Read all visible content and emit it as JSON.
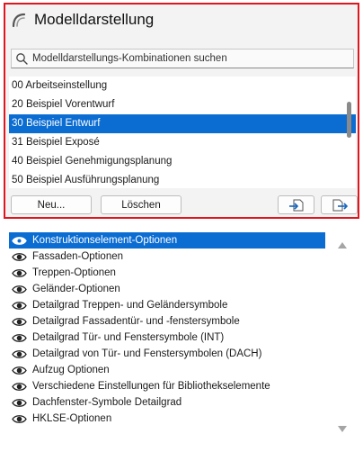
{
  "panel": {
    "title": "Modelldarstellung",
    "search_placeholder": "Modelldarstellungs-Kombinationen suchen"
  },
  "combinations": [
    {
      "label": "00 Arbeitseinstellung",
      "selected": false
    },
    {
      "label": "20 Beispiel Vorentwurf",
      "selected": false
    },
    {
      "label": "30 Beispiel Entwurf",
      "selected": true
    },
    {
      "label": "31 Beispiel Exposé",
      "selected": false
    },
    {
      "label": "40 Beispiel Genehmigungsplanung",
      "selected": false
    },
    {
      "label": "50 Beispiel Ausführungsplanung",
      "selected": false
    }
  ],
  "buttons": {
    "new_label": "Neu...",
    "delete_label": "Löschen",
    "import_icon": "import-icon",
    "export_icon": "export-icon"
  },
  "options": [
    {
      "label": "Konstruktionselement-Optionen",
      "selected": true
    },
    {
      "label": "Fassaden-Optionen",
      "selected": false
    },
    {
      "label": "Treppen-Optionen",
      "selected": false
    },
    {
      "label": "Geländer-Optionen",
      "selected": false
    },
    {
      "label": "Detailgrad Treppen- und Geländersymbole",
      "selected": false
    },
    {
      "label": "Detailgrad Fassadentür- und -fenstersymbole",
      "selected": false
    },
    {
      "label": "Detailgrad Tür- und Fenstersymbole (INT)",
      "selected": false
    },
    {
      "label": "Detailgrad von Tür- und Fenstersymbolen (DACH)",
      "selected": false
    },
    {
      "label": "Aufzug Optionen",
      "selected": false
    },
    {
      "label": "Verschiedene Einstellungen für Bibliothekselemente",
      "selected": false
    },
    {
      "label": "Dachfenster-Symbole Detailgrad",
      "selected": false
    },
    {
      "label": "HKLSE-Optionen",
      "selected": false
    }
  ],
  "colors": {
    "highlight_border": "#e0161e",
    "selection": "#0b6cd2"
  }
}
